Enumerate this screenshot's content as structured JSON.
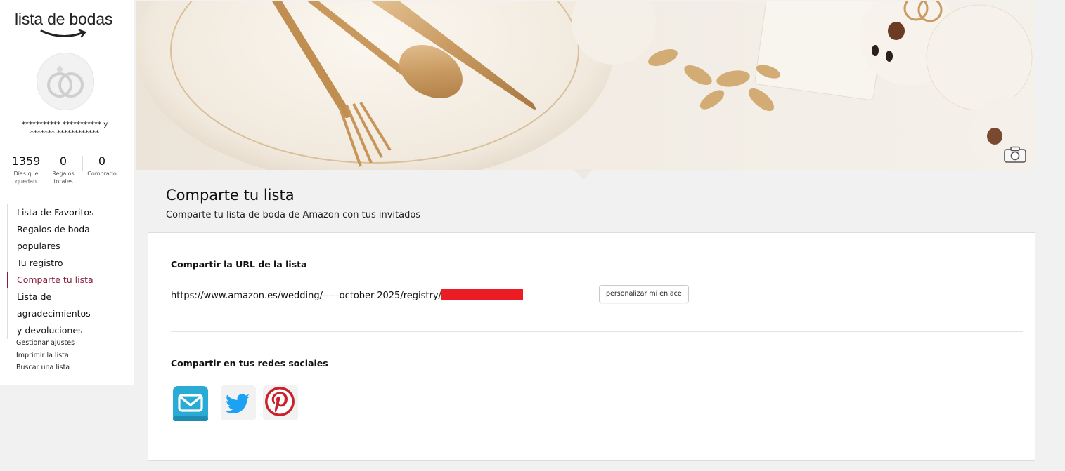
{
  "sidebar": {
    "logo_text": "lista de bodas",
    "couple_line1": "*********** *********** y",
    "couple_line2": "******* ************",
    "stats": [
      {
        "number": "1359",
        "label1": "Días que",
        "label2": "quedan"
      },
      {
        "number": "0",
        "label1": "Regalos",
        "label2": "totales"
      },
      {
        "number": "0",
        "label1": "Comprado",
        "label2": ""
      }
    ],
    "nav": [
      {
        "label": "Lista de Favoritos"
      },
      {
        "label": "Regalos de boda"
      },
      {
        "label": "populares"
      },
      {
        "label": "Tu registro"
      },
      {
        "label": "Comparte tu lista"
      },
      {
        "label": "Lista de agradecimientos"
      },
      {
        "label": "y devoluciones"
      }
    ],
    "links": [
      {
        "label": "Gestionar ajustes"
      },
      {
        "label": "Imprimir la lista"
      },
      {
        "label": "Buscar una lista"
      }
    ]
  },
  "header": {
    "title": "Comparte tu lista",
    "subtitle": "Comparte tu lista de boda de Amazon con tus invitados"
  },
  "share": {
    "url_title": "Compartir la URL de la lista",
    "url": "https://www.amazon.es/wedding/-----october-2025/registry/",
    "customize_button": "personalizar mi enlace",
    "social_title": "Compartir en tus redes sociales",
    "social": [
      {
        "icon": "email-icon",
        "color": "#29abd5"
      },
      {
        "icon": "twitter-icon",
        "color": "#1da1f2"
      },
      {
        "icon": "pinterest-icon",
        "color": "#c8232c"
      }
    ]
  },
  "colors": {
    "active_nav": "#8a1f3c",
    "redaction": "#ec1c24",
    "page_bg": "#f1f1f1"
  }
}
